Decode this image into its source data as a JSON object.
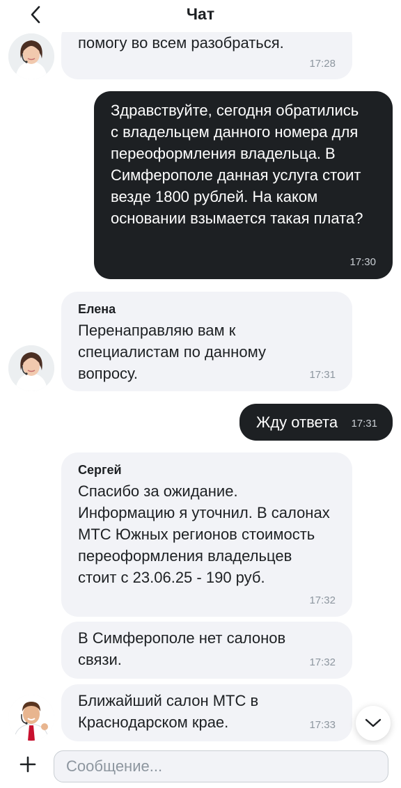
{
  "header": {
    "title": "Чат"
  },
  "messages": [
    {
      "text": "помогу во всем разобраться.",
      "time": "17:28"
    },
    {
      "text": "Здравствуйте, сегодня обратились с владельцем данного номера для переоформления владельца. В Симферополе данная услуга стоит везде 1800 рублей. На каком основании взымается такая плата?",
      "time": "17:30"
    },
    {
      "sender": "Елена",
      "text": "Перенаправляю вам к специалистам по данному вопросу.",
      "time": "17:31"
    },
    {
      "text": "Жду ответа",
      "time": "17:31"
    },
    {
      "sender": "Сергей",
      "text": "Спасибо за ожидание. Информацию я уточнил. В салонах МТС Южных регионов стоимость переоформления владельцев стоит с 23.06.25 - 190 руб.",
      "time": "17:32"
    },
    {
      "text": "В Симферополе нет салонов связи.",
      "time": "17:32"
    },
    {
      "text": "Ближайший салон МТС в Краснодарском крае.",
      "time": "17:33"
    }
  ],
  "composer": {
    "placeholder": "Сообщение..."
  },
  "colors": {
    "outgoing_bubble": "#1d2023",
    "incoming_bubble": "#f2f3f7",
    "timestamp": "#8d969f"
  },
  "icons": {
    "back": "chevron-left-icon",
    "scroll": "chevron-down-icon",
    "add": "plus-icon"
  }
}
